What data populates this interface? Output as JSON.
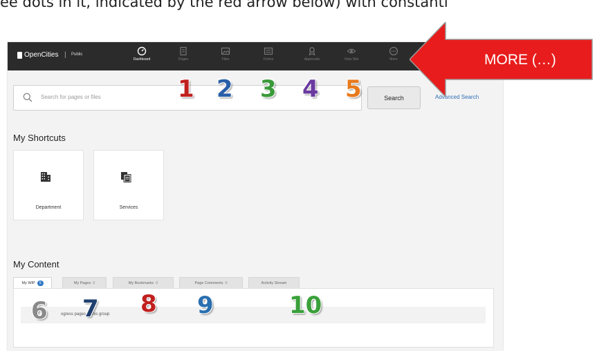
{
  "caption": "ee dots in it, indicated by the red arrow below) with constantl",
  "brand": {
    "name": "OpenCities",
    "separator": "|",
    "env": "Public"
  },
  "nav": {
    "items": [
      {
        "label": "Dashboard",
        "icon": "gauge-icon",
        "active": true
      },
      {
        "label": "Pages",
        "icon": "page-icon",
        "active": false
      },
      {
        "label": "Files",
        "icon": "image-icon",
        "active": false
      },
      {
        "label": "Forms",
        "icon": "form-icon",
        "active": false
      },
      {
        "label": "Approvals",
        "icon": "approval-icon",
        "active": false
      },
      {
        "label": "View Site",
        "icon": "eye-icon",
        "active": false
      },
      {
        "label": "More",
        "icon": "more-icon",
        "active": false
      }
    ]
  },
  "search": {
    "placeholder": "Search for pages or files",
    "button": "Search",
    "advanced": "Advanced Search"
  },
  "shortcuts": {
    "title": "My Shortcuts",
    "items": [
      {
        "label": "Department",
        "icon": "building-icon"
      },
      {
        "label": "Services",
        "icon": "documents-icon"
      }
    ]
  },
  "content": {
    "title": "My Content",
    "tabs": [
      {
        "label": "My WIP",
        "count": "5"
      },
      {
        "label": "My Pages",
        "count": "0"
      },
      {
        "label": "My Bookmarks",
        "count": "0"
      },
      {
        "label": "Page Comments",
        "count": "0"
      },
      {
        "label": "Activity Stream",
        "count": ""
      }
    ],
    "message": "ogress pages in this group"
  },
  "annotations": {
    "numbers": [
      {
        "text": "1",
        "color": "#c0201e"
      },
      {
        "text": "2",
        "color": "#2a5fa8"
      },
      {
        "text": "3",
        "color": "#3a9a3a"
      },
      {
        "text": "4",
        "color": "#6a3aa0"
      },
      {
        "text": "5",
        "color": "#e87a1e"
      },
      {
        "text": "6",
        "color": "#8a8a8a"
      },
      {
        "text": "7",
        "color": "#1f3f6e"
      },
      {
        "text": "8",
        "color": "#c0201e"
      },
      {
        "text": "9",
        "color": "#2a6fb0"
      },
      {
        "text": "10",
        "color": "#3aa03a"
      }
    ],
    "arrow_label": "MORE (…)",
    "arrow_color": "#e81c1c"
  }
}
